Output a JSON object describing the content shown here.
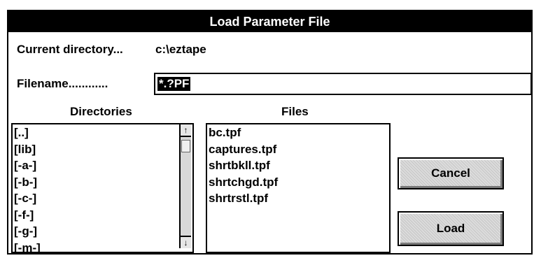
{
  "dialog": {
    "title": "Load Parameter File",
    "current_directory_label": "Current directory...",
    "current_directory_value": "c:\\eztape",
    "filename_label": "Filename............",
    "filename_value": "*.?PF",
    "directories_header": "Directories",
    "files_header": "Files",
    "directories": [
      "[..]",
      "[lib]",
      "[-a-]",
      "[-b-]",
      "[-c-]",
      "[-f-]",
      "[-g-]",
      "[-m-]"
    ],
    "files": [
      "bc.tpf",
      "captures.tpf",
      "shrtbkll.tpf",
      "shrtchgd.tpf",
      "shrtrstl.tpf"
    ],
    "cancel_label": "Cancel",
    "load_label": "Load",
    "scroll_up_glyph": "↑",
    "scroll_down_glyph": "↓"
  }
}
